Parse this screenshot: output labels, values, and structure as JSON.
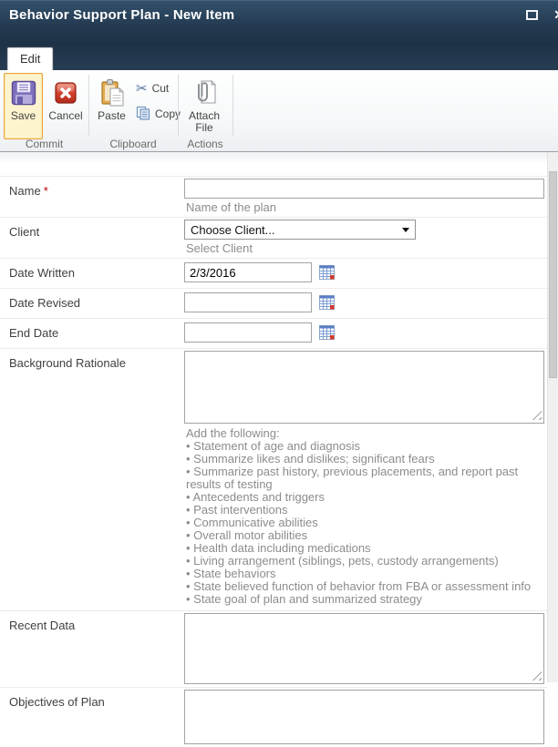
{
  "window": {
    "title": "Behavior Support Plan - New Item"
  },
  "ribbon": {
    "tab_label": "Edit",
    "buttons": {
      "save": "Save",
      "cancel": "Cancel",
      "paste": "Paste",
      "cut": "Cut",
      "copy": "Copy",
      "attach_file": "Attach File"
    },
    "groups": {
      "commit": "Commit",
      "clipboard": "Clipboard",
      "actions": "Actions"
    }
  },
  "colors": {
    "titlebar": "#22374b",
    "save_highlight_bg": "#fdf3cf",
    "save_highlight_border": "#e8a33d",
    "required_mark": "#c00000"
  },
  "form": {
    "name": {
      "label": "Name",
      "required_mark": "*",
      "value": "",
      "description": "Name of the plan"
    },
    "client": {
      "label": "Client",
      "value": "Choose Client...",
      "description": "Select Client"
    },
    "date_written": {
      "label": "Date Written",
      "value": "2/3/2016"
    },
    "date_revised": {
      "label": "Date Revised",
      "value": ""
    },
    "end_date": {
      "label": "End Date",
      "value": ""
    },
    "background": {
      "label": "Background Rationale",
      "value": "",
      "help_intro": "Add the following:",
      "bullets": [
        "• Statement of age and diagnosis",
        "• Summarize likes and dislikes; significant fears",
        "• Summarize past history, previous placements, and report past results of testing",
        "• Antecedents and triggers",
        "• Past interventions",
        "• Communicative abilities",
        "• Overall motor abilities",
        "• Health data including medications",
        "• Living arrangement (siblings, pets, custody arrangements)",
        "• State behaviors",
        "• State believed function of behavior from FBA or assessment info",
        "• State goal of plan and summarized strategy"
      ]
    },
    "recent_data": {
      "label": "Recent Data",
      "value": ""
    },
    "objectives": {
      "label": "Objectives of Plan",
      "value": ""
    }
  }
}
